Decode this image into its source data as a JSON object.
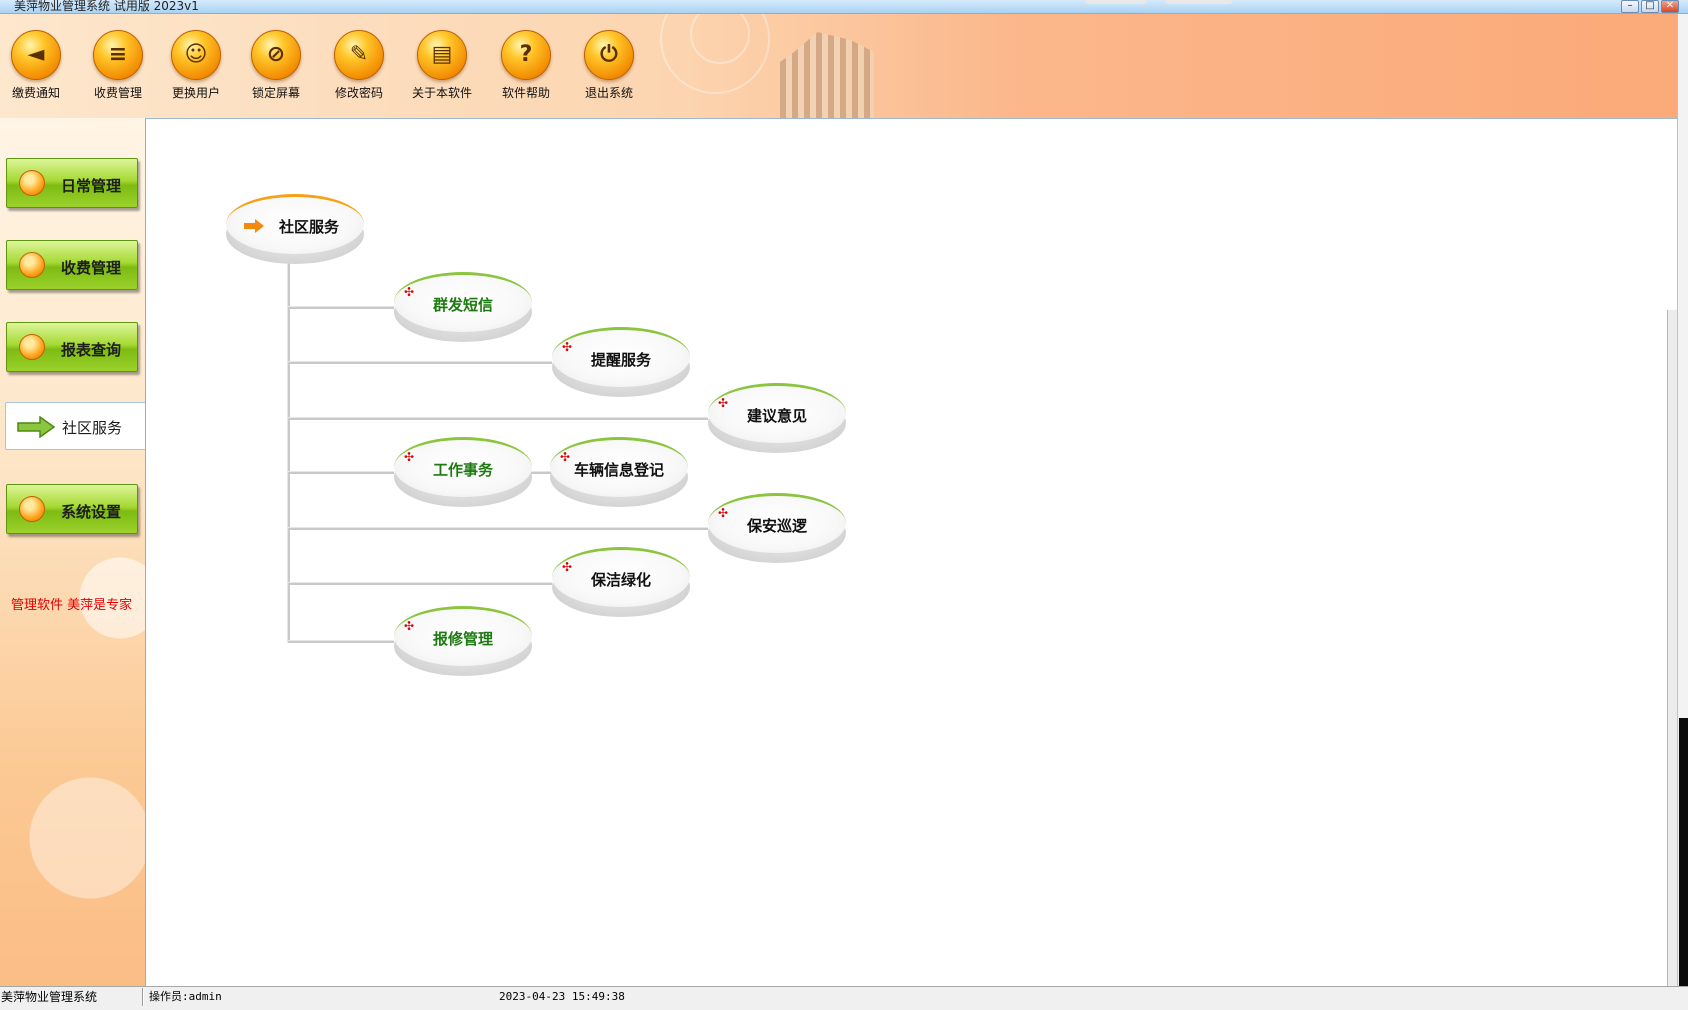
{
  "window": {
    "title": "美萍物业管理系统 试用版 2023v1",
    "controls": {
      "minimize": "–",
      "maximize": "□",
      "close": "✕"
    }
  },
  "toolbar": {
    "items": [
      {
        "label": "缴费通知",
        "icon": "megaphone-icon",
        "glyph": "◄"
      },
      {
        "label": "收费管理",
        "icon": "document-list-icon",
        "glyph": "≡"
      },
      {
        "label": "更换用户",
        "icon": "user-switch-icon",
        "glyph": "☺"
      },
      {
        "label": "锁定屏幕",
        "icon": "lock-screen-icon",
        "glyph": "⊘"
      },
      {
        "label": "修改密码",
        "icon": "wrench-key-icon",
        "glyph": "✎"
      },
      {
        "label": "关于本软件",
        "icon": "about-document-icon",
        "glyph": "▤"
      },
      {
        "label": "软件帮助",
        "icon": "question-mark-icon",
        "glyph": "?"
      },
      {
        "label": "退出系统",
        "icon": "power-icon",
        "glyph": "⏻"
      }
    ]
  },
  "sidebar": {
    "items": [
      {
        "label": "日常管理",
        "active": false
      },
      {
        "label": "收费管理",
        "active": false
      },
      {
        "label": "报表查询",
        "active": false
      },
      {
        "label": "社区服务",
        "active": true
      },
      {
        "label": "系统设置",
        "active": false
      }
    ],
    "slogan": "管理软件 美萍是专家"
  },
  "tree": {
    "root": "社区服务",
    "nodes": [
      {
        "label": "群发短信",
        "style": "green"
      },
      {
        "label": "提醒服务",
        "style": "black"
      },
      {
        "label": "建议意见",
        "style": "black"
      },
      {
        "label": "工作事务",
        "style": "green"
      },
      {
        "label": "车辆信息登记",
        "style": "black"
      },
      {
        "label": "保安巡逻",
        "style": "black"
      },
      {
        "label": "保洁绿化",
        "style": "black"
      },
      {
        "label": "报修管理",
        "style": "green"
      }
    ],
    "node_marker": "✣"
  },
  "statusbar": {
    "app_name": "美萍物业管理系统",
    "operator": "操作员:admin",
    "datetime": "2023-04-23 15:49:38"
  },
  "colors": {
    "accent_orange": "#f5a015",
    "accent_green": "#8cc440",
    "marker_red": "#d60000",
    "slogan_red": "#e00000"
  }
}
